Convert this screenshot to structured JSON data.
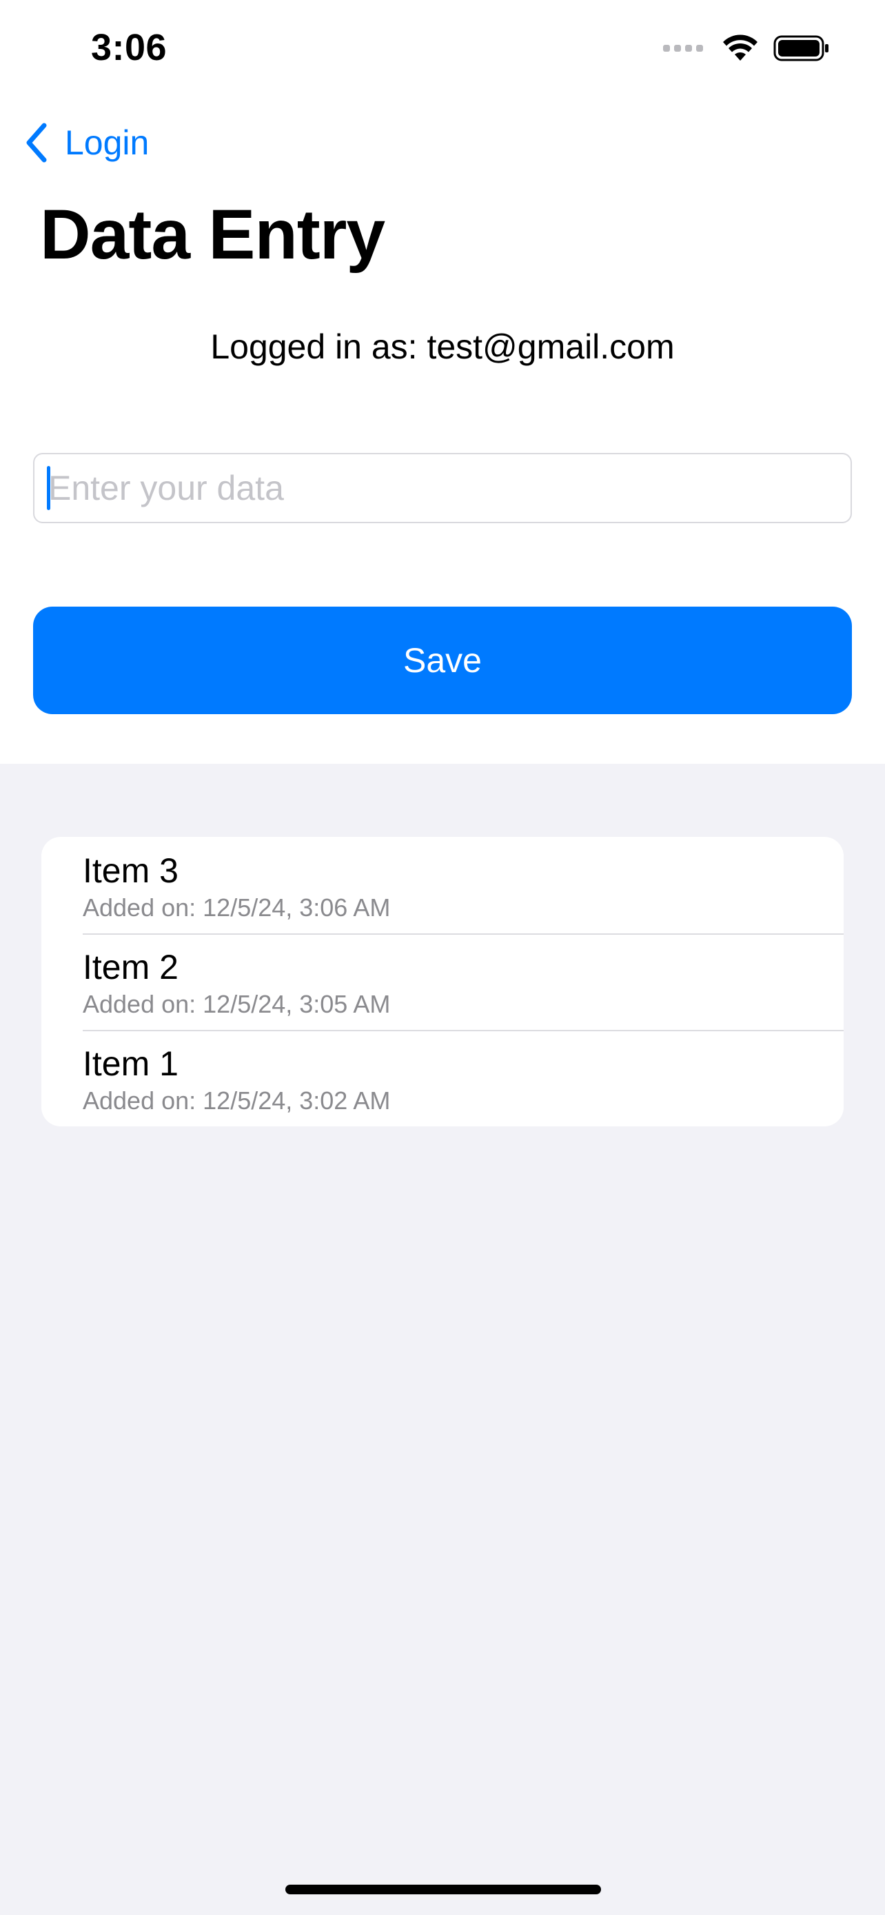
{
  "status_bar": {
    "time": "3:06",
    "icons": [
      "cellular-signal-icon",
      "wifi-icon",
      "battery-icon"
    ]
  },
  "nav": {
    "back_label": "Login",
    "back_icon": "chevron-left-icon"
  },
  "page": {
    "title": "Data Entry",
    "logged_in_text": "Logged in as: test@gmail.com"
  },
  "form": {
    "input_placeholder": "Enter your data",
    "input_value": "",
    "save_label": "Save"
  },
  "items": [
    {
      "title": "Item 3",
      "date": "Added on: 12/5/24, 3:06 AM"
    },
    {
      "title": "Item 2",
      "date": "Added on: 12/5/24, 3:05 AM"
    },
    {
      "title": "Item 1",
      "date": "Added on: 12/5/24, 3:02 AM"
    }
  ],
  "colors": {
    "accent": "#007aff",
    "background_grouped": "#f2f2f7",
    "secondary_text": "#8a8a8e"
  }
}
